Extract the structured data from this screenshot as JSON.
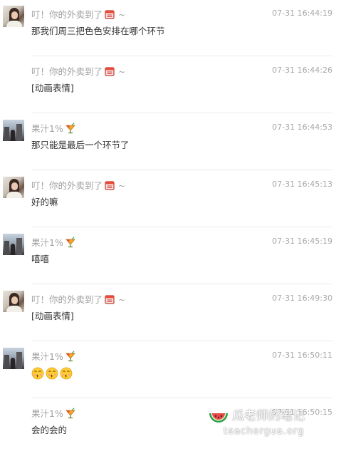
{
  "nick_tilde": "~",
  "messages": [
    {
      "sender": "叮！你的外卖到了",
      "time": "07-31 16:44:19",
      "text": "那我们周三把色色安排在哪个环节"
    },
    {
      "sender": "叮！你的外卖到了",
      "time": "07-31 16:44:26",
      "text": "[动画表情]"
    },
    {
      "sender": "果汁1%",
      "time": "07-31 16:44:53",
      "text": "那只能是最后一个环节了"
    },
    {
      "sender": "叮！你的外卖到了",
      "time": "07-31 16:45:13",
      "text": "好的嘛"
    },
    {
      "sender": "果汁1%",
      "time": "07-31 16:45:19",
      "text": "嘻嘻"
    },
    {
      "sender": "叮！你的外卖到了",
      "time": "07-31 16:49:30",
      "text": "[动画表情]"
    },
    {
      "sender": "果汁1%",
      "time": "07-31 16:50:11",
      "text": ""
    },
    {
      "sender": "果汁1%",
      "time": "07-31 16:50:15",
      "text": "会的会的"
    }
  ],
  "icons": {
    "takeout_box": "takeout-box-icon",
    "juice_cup": "juice-cup-icon",
    "kiss_emoji": "kissing-face-emoji-icon"
  },
  "colors": {
    "sender_name": "#a0a0a0",
    "timestamp": "#a9a9a9",
    "message_text": "#333333",
    "separator": "#ececec"
  },
  "watermark": {
    "title": "瓜老师的笔记",
    "url": "teachergua.org"
  }
}
